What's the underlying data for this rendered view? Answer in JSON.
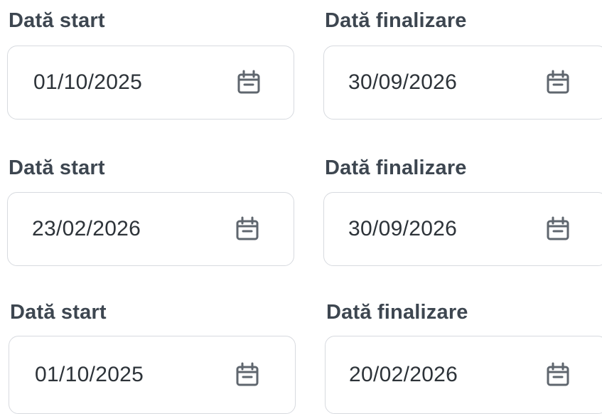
{
  "rows": [
    {
      "start": {
        "label": "Dată start",
        "value": "01/10/2025",
        "icon": "calendar-icon"
      },
      "end": {
        "label": "Dată finalizare",
        "value": "30/09/2026",
        "icon": "calendar-icon"
      }
    },
    {
      "start": {
        "label": "Dată start",
        "value": "23/02/2026",
        "icon": "calendar-icon"
      },
      "end": {
        "label": "Dată finalizare",
        "value": "30/09/2026",
        "icon": "calendar-icon"
      }
    },
    {
      "start": {
        "label": "Dată start",
        "value": "01/10/2025",
        "icon": "calendar-icon"
      },
      "end": {
        "label": "Dată finalizare",
        "value": "20/02/2026",
        "icon": "calendar-icon"
      }
    }
  ],
  "colors": {
    "label": "#3d4650",
    "value": "#2d3339",
    "border": "#d7dadf",
    "icon": "#5f666e"
  }
}
